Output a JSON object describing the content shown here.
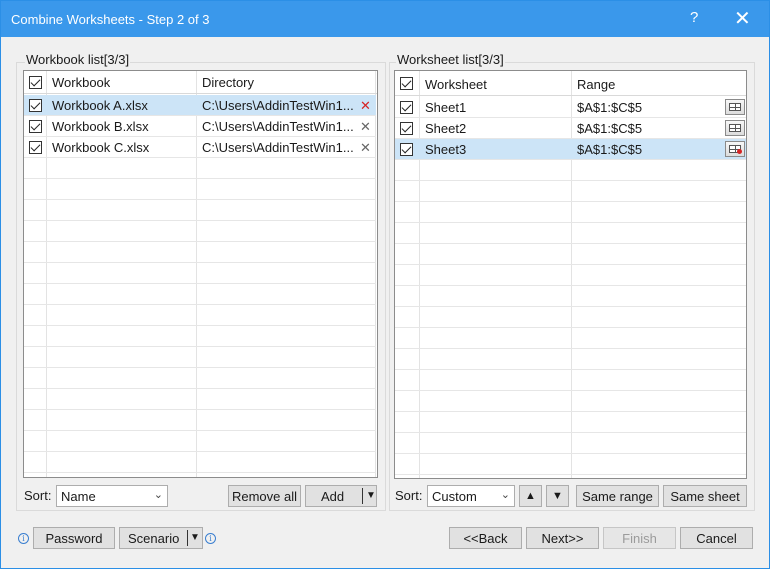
{
  "window": {
    "title": "Combine Worksheets - Step 2 of 3",
    "help_label": "?",
    "close_label": "✕"
  },
  "workbook_panel": {
    "group_label": "Workbook list[3/3]",
    "headers": {
      "name": "Workbook",
      "directory": "Directory"
    },
    "rows": [
      {
        "name": "Workbook A.xlsx",
        "directory": "C:\\Users\\AddinTestWin1...",
        "checked": true,
        "selected": true
      },
      {
        "name": "Workbook B.xlsx",
        "directory": "C:\\Users\\AddinTestWin1...",
        "checked": true,
        "selected": false
      },
      {
        "name": "Workbook C.xlsx",
        "directory": "C:\\Users\\AddinTestWin1...",
        "checked": true,
        "selected": false
      }
    ],
    "sort_label": "Sort:",
    "sort_value": "Name",
    "remove_all_label": "Remove all",
    "add_label": "Add"
  },
  "worksheet_panel": {
    "group_label": "Worksheet list[3/3]",
    "headers": {
      "name": "Worksheet",
      "range": "Range"
    },
    "rows": [
      {
        "name": "Sheet1",
        "range": "$A$1:$C$5",
        "checked": true,
        "selected": false
      },
      {
        "name": "Sheet2",
        "range": "$A$1:$C$5",
        "checked": true,
        "selected": false
      },
      {
        "name": "Sheet3",
        "range": "$A$1:$C$5",
        "checked": true,
        "selected": true
      }
    ],
    "sort_label": "Sort:",
    "sort_value": "Custom",
    "up_label": "▲",
    "down_label": "▼",
    "same_range_label": "Same range",
    "same_sheet_label": "Same sheet"
  },
  "footer": {
    "password_label": "Password",
    "scenario_label": "Scenario",
    "back_label": "<<Back",
    "next_label": "Next>>",
    "finish_label": "Finish",
    "cancel_label": "Cancel"
  },
  "colors": {
    "titlebar": "#3a98eb",
    "selection": "#cce4f7",
    "remove_active": "#d62323"
  }
}
